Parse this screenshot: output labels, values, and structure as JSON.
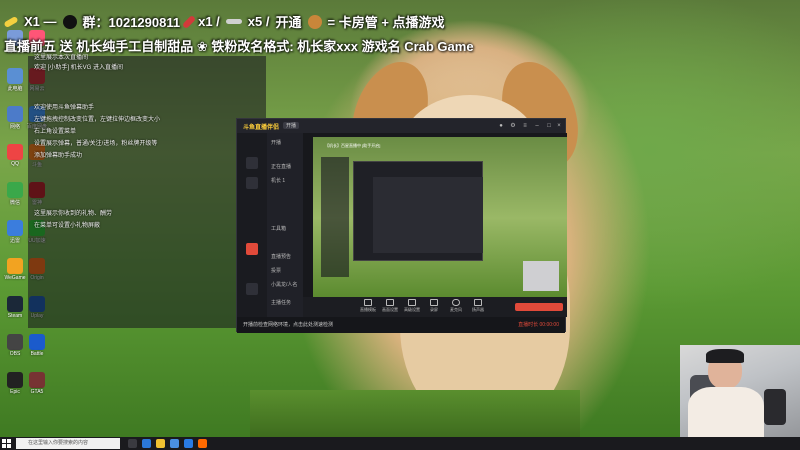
{
  "overlay": {
    "line1": {
      "qq_prefix": "X1 —",
      "qq_label": "群：1021290811",
      "rocket_count": "x1 /",
      "plane_count": "x5 /",
      "open_label": "开通",
      "open_reward": "= 卡房管 + 点播游戏"
    },
    "line2": "直播前五 送 机长纯手工自制甜品 ❀ 铁粉改名格式: 机长家xxx 游戏名 Crab Game"
  },
  "chat_panel": {
    "lines": [
      "这里展示本次直播间",
      "欢迎 [小助手] 机长VG 进入直播间",
      "欢迎使用斗鱼弹幕助手",
      "左键拖拽控制改变位置，左键拉伸边框改变大小",
      "右上角设置菜单",
      "设置展示弹幕，普通/关注/进场，粉丝牌开级等",
      "添加弹幕助手成功",
      "这里展示你收到的礼物、酬劳",
      "在菜单可设置小礼物屏蔽"
    ]
  },
  "stream_app": {
    "logo": "斗鱼直播伴侣",
    "badge": "开播",
    "title": "【机长】百星直播中 [助手开启]",
    "nav": [
      "开播",
      "正在直播",
      "机长 1",
      "工具箱",
      "直播预告",
      "投票",
      "小黑龙/人名",
      "主播任务"
    ],
    "toolbar": [
      "直播模板",
      "画面设置",
      "高级设置",
      "录屏",
      "麦克风",
      "扬声器"
    ],
    "status_text": "开播前检查网络环境，点击此处测速检测",
    "status_right": "直播时长 00:00:00"
  },
  "taskbar": {
    "search_placeholder": "在这里输入你要搜索的内容"
  },
  "desktop_icons": [
    "回收站",
    "此电脑",
    "网络",
    "QQ",
    "微信",
    "迅雷",
    "WeGame",
    "Steam",
    "OBS",
    "Epic",
    "腾讯视频",
    "网易云",
    "百度网盘",
    "斗鱼",
    "雷神",
    "UU加速",
    "Origin",
    "Uplay",
    "Battle",
    "GTA5"
  ]
}
